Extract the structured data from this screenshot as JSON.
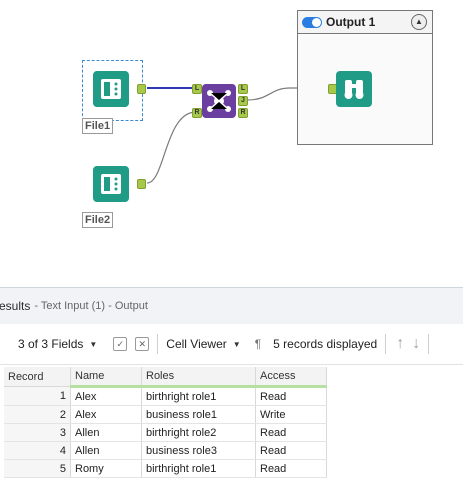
{
  "canvas": {
    "tools": {
      "input1": {
        "label": "File1",
        "icon": "book-input-icon"
      },
      "input2": {
        "label": "File2",
        "icon": "book-input-icon"
      },
      "join": {
        "icon": "join-icon",
        "anchors_in": [
          "L",
          "R"
        ],
        "anchors_out": [
          "L",
          "J",
          "R"
        ]
      },
      "browse": {
        "icon": "binoculars-icon"
      }
    },
    "output_panel": {
      "title": "Output 1",
      "collapse_icon": "chevron-up-icon"
    }
  },
  "results": {
    "title": "esults",
    "subtitle": "- Text Input (1) - Output"
  },
  "toolbar": {
    "fields": "3 of 3 Fields",
    "view": "Cell Viewer",
    "pilcrow": "¶",
    "records": "5 records displayed",
    "up": "↑",
    "down": "↓"
  },
  "table": {
    "headers": [
      "Record",
      "Name",
      "Roles",
      "Access"
    ],
    "rows": [
      [
        "1",
        "Alex",
        "birthright role1",
        "Read"
      ],
      [
        "2",
        "Alex",
        "business role1",
        "Write"
      ],
      [
        "3",
        "Allen",
        "birthright role2",
        "Read"
      ],
      [
        "4",
        "Allen",
        "business role3",
        "Read"
      ],
      [
        "5",
        "Romy",
        "birthright role1",
        "Read"
      ]
    ]
  },
  "colors": {
    "tool_teal": "#1f9b86",
    "join_purple": "#6b3fa0",
    "anchor_green": "#a7c84b",
    "connector_blue": "#2f3bb6"
  }
}
